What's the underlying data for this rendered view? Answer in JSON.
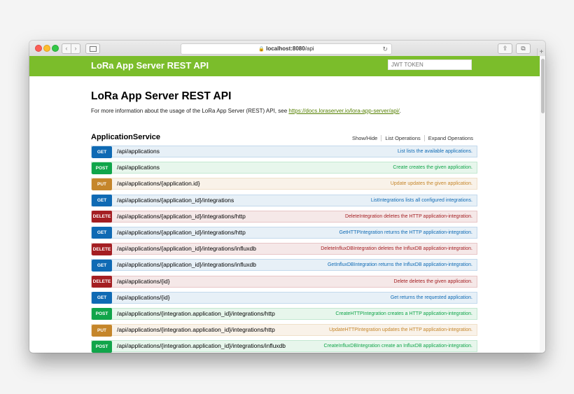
{
  "browser": {
    "url_host": "localhost:8080",
    "url_path": "/api",
    "back_glyph": "‹",
    "forward_glyph": "›",
    "reload_glyph": "↻",
    "lock_glyph": "🔒",
    "share_glyph": "⇪",
    "tabs_glyph": "⧉",
    "newtab_glyph": "+"
  },
  "header": {
    "brand": "LoRa App Server REST API",
    "jwt_placeholder": "JWT TOKEN"
  },
  "main": {
    "title": "LoRa App Server REST API",
    "intro_text": "For more information about the usage of the LoRa App Server (REST) API, see ",
    "intro_link": "https://docs.loraserver.io/lora-app-server/api/",
    "intro_end": "."
  },
  "service": {
    "name": "ApplicationService",
    "links": [
      "Show/Hide",
      "List Operations",
      "Expand Operations"
    ],
    "operations": [
      {
        "method": "GET",
        "path": "/api/applications",
        "summary": "List lists the available applications."
      },
      {
        "method": "POST",
        "path": "/api/applications",
        "summary": "Create creates the given application."
      },
      {
        "method": "PUT",
        "path": "/api/applications/{application.id}",
        "summary": "Update updates the given application."
      },
      {
        "method": "GET",
        "path": "/api/applications/{application_id}/integrations",
        "summary": "ListIntegrations lists all configured integrations."
      },
      {
        "method": "DELETE",
        "path": "/api/applications/{application_id}/integrations/http",
        "summary": "DeleteIntegration deletes the HTTP application-integration."
      },
      {
        "method": "GET",
        "path": "/api/applications/{application_id}/integrations/http",
        "summary": "GetHTTPIntegration returns the HTTP application-integration."
      },
      {
        "method": "DELETE",
        "path": "/api/applications/{application_id}/integrations/influxdb",
        "summary": "DeleteInfluxDBIntegration deletes the InfluxDB application-integration."
      },
      {
        "method": "GET",
        "path": "/api/applications/{application_id}/integrations/influxdb",
        "summary": "GetInfluxDBIntegration returns the InfluxDB application-integration."
      },
      {
        "method": "DELETE",
        "path": "/api/applications/{id}",
        "summary": "Delete deletes the given application."
      },
      {
        "method": "GET",
        "path": "/api/applications/{id}",
        "summary": "Get returns the requested application."
      },
      {
        "method": "POST",
        "path": "/api/applications/{integration.application_id}/integrations/http",
        "summary": "CreateHTTPIntegration creates a HTTP application-integration."
      },
      {
        "method": "PUT",
        "path": "/api/applications/{integration.application_id}/integrations/http",
        "summary": "UpdateHTTPIntegration updates the HTTP application-integration."
      },
      {
        "method": "POST",
        "path": "/api/applications/{integration.application_id}/integrations/influxdb",
        "summary": "CreateInfluxDBIntegration create an InfluxDB application-integration."
      }
    ]
  },
  "colors": {
    "header_green": "#7bbd2b",
    "get": "#0f6ab4",
    "post": "#10a54a",
    "put": "#c5862b",
    "delete": "#a41e22"
  }
}
